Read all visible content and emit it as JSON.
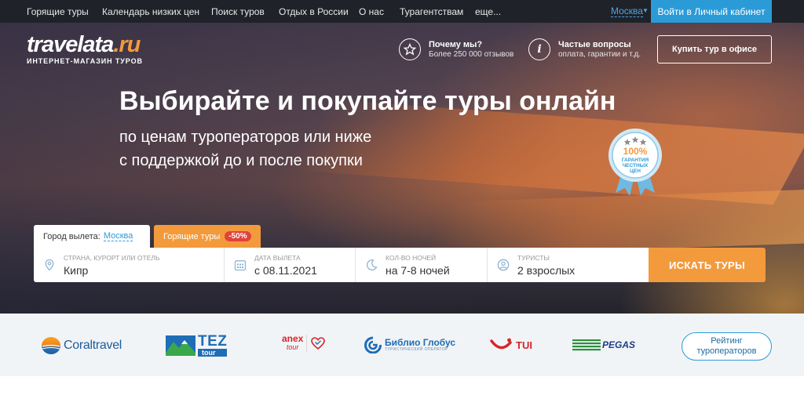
{
  "topnav": {
    "items": [
      "Горящие туры",
      "Календарь низких цен",
      "Поиск туров",
      "Отдых в России",
      "О нас",
      "Турагентствам",
      "еще..."
    ],
    "city": "Москва",
    "cabinet_label": "Войти в Личный кабинет"
  },
  "header": {
    "brand_main": "travelata",
    "brand_suffix": ".ru",
    "tagline": "ИНТЕРНЕТ-МАГАЗИН ТУРОВ",
    "why": {
      "title": "Почему мы?",
      "subtitle": "Более 250 000 отзывов",
      "icon": "star-icon"
    },
    "faq": {
      "title": "Частые вопросы",
      "subtitle": "оплата, гарантии и т.д.",
      "icon": "info-icon"
    },
    "office_button": "Купить тур в офисе"
  },
  "hero": {
    "headline": "Выбирайте и покупайте туры онлайн",
    "sub_line1": "по ценам туроператоров или ниже",
    "sub_line2": "с поддержкой до и после покупки",
    "badge": {
      "percent": "100%",
      "line1": "ГАРАНТИЯ",
      "line2": "ЧЕСТНЫХ",
      "line3": "ЦЕН"
    }
  },
  "search": {
    "departure_label": "Город вылета:",
    "departure_city": "Москва",
    "hot_tab_label": "Горящие туры",
    "hot_tab_discount": "-50%",
    "fields": [
      {
        "label": "СТРАНА, КУРОРТ ИЛИ ОТЕЛЬ",
        "value": "Кипр",
        "icon": "location-pin-icon"
      },
      {
        "label": "ДАТА ВЫЛЕТА",
        "value": "с 08.11.2021",
        "icon": "calendar-icon"
      },
      {
        "label": "КОЛ-ВО НОЧЕЙ",
        "value": "на 7-8 ночей",
        "icon": "moon-icon"
      },
      {
        "label": "ТУРИСТЫ",
        "value": "2 взрослых",
        "icon": "person-icon"
      }
    ],
    "submit_label": "ИСКАТЬ ТУРЫ"
  },
  "partners": {
    "coral": "Coraltravel",
    "tez_main": "TEZ",
    "tez_sub": "tour",
    "anex_main": "anex",
    "anex_sub": "tour",
    "biblio": "Библио Глобус",
    "biblio_sub": "ТУРИСТИЧЕСКИЙ ОПЕРАТОР",
    "tui": "TUI",
    "pegas": "PEGAS",
    "rating_line1": "Рейтинг",
    "rating_line2": "туроператоров"
  },
  "colors": {
    "accent_orange": "#f39a3c",
    "accent_blue": "#2b9bd8",
    "nav_bg": "#1f2229"
  }
}
